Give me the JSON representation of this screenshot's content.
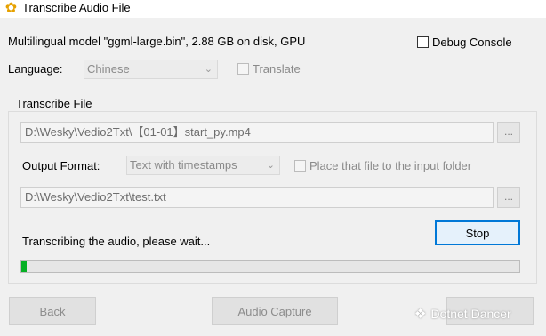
{
  "window": {
    "title": "Transcribe Audio File",
    "icon": "sunflower-app-icon"
  },
  "model_info": "Multilingual model \"ggml-large.bin\", 2.88 GB on disk, GPU",
  "debug_console": {
    "label": "Debug Console",
    "checked": false
  },
  "language": {
    "label": "Language:",
    "value": "Chinese"
  },
  "translate": {
    "label": "Translate",
    "checked": false
  },
  "transcribe_group": {
    "title": "Transcribe File",
    "input_path": "D:\\Wesky\\Vedio2Txt\\【01-01】start_py.mp4",
    "browse_label": "...",
    "output_format": {
      "label": "Output Format:",
      "value": "Text with timestamps"
    },
    "place_in_input_folder": {
      "label": "Place that file to the input folder",
      "checked": false
    },
    "output_path": "D:\\Wesky\\Vedio2Txt\\test.txt",
    "status": "Transcribing the audio, please wait...",
    "stop_label": "Stop",
    "progress_percent": 1
  },
  "footer": {
    "back_label": "Back",
    "audio_capture_label": "Audio Capture",
    "watermark": "Dotnet Dancer"
  },
  "colors": {
    "accent": "#0078d7",
    "progress": "#06b025"
  }
}
